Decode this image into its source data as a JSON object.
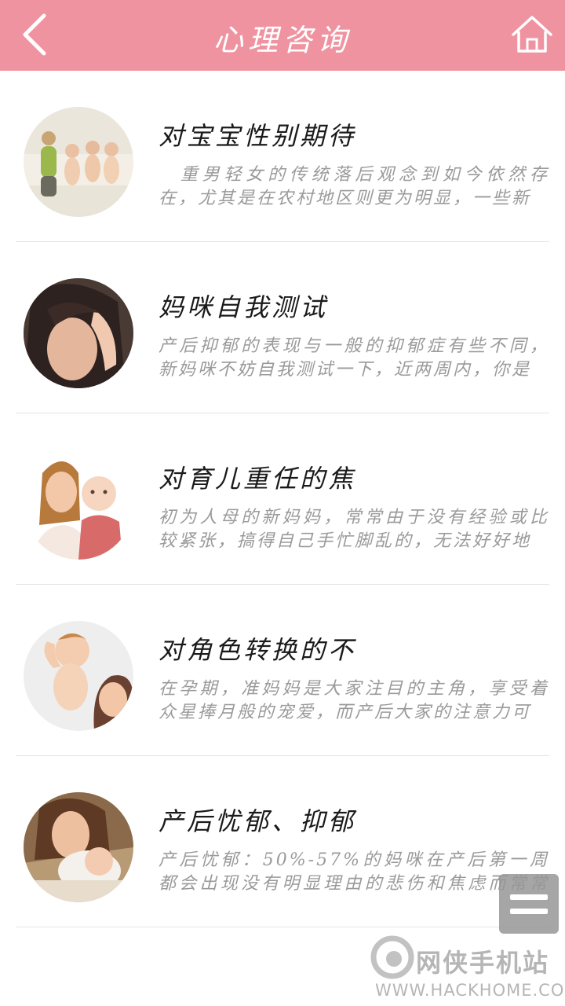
{
  "header": {
    "title": "心理咨询",
    "back_icon": "chevron-left-icon",
    "home_icon": "home-icon",
    "color": "#ef93a1"
  },
  "articles": [
    {
      "title": "对宝宝性别期待",
      "desc": "　重男轻女的传统落后观念到如今依然存在，尤其是在农村地区则更为明显，一些新",
      "thumb": "mother-with-three-babies"
    },
    {
      "title": "妈咪自我测试",
      "desc": "产后抑郁的表现与一般的抑郁症有些不同，新妈咪不妨自我测试一下，近两周内，你是",
      "thumb": "stressed-woman"
    },
    {
      "title": "对育儿重任的焦",
      "desc": "初为人母的新妈妈，常常由于没有经验或比较紧张，搞得自己手忙脚乱的，无法好好地",
      "thumb": "mother-holding-baby"
    },
    {
      "title": "对角色转换的不",
      "desc": "在孕期，准妈妈是大家注目的主角，享受着众星捧月般的宠爱，而产后大家的注意力可",
      "thumb": "mother-lifting-baby"
    },
    {
      "title": "产后忧郁、抑郁",
      "desc": "产后忧郁：50%-57%的妈咪在产后第一周都会出现没有明显理由的悲伤和焦虑而常常哭",
      "thumb": "mother-with-sleeping-baby"
    }
  ],
  "menu_button": {
    "icon": "menu-icon"
  },
  "watermark": {
    "name": "网侠手机站",
    "url": "WWW.HACKHOME.COM"
  }
}
